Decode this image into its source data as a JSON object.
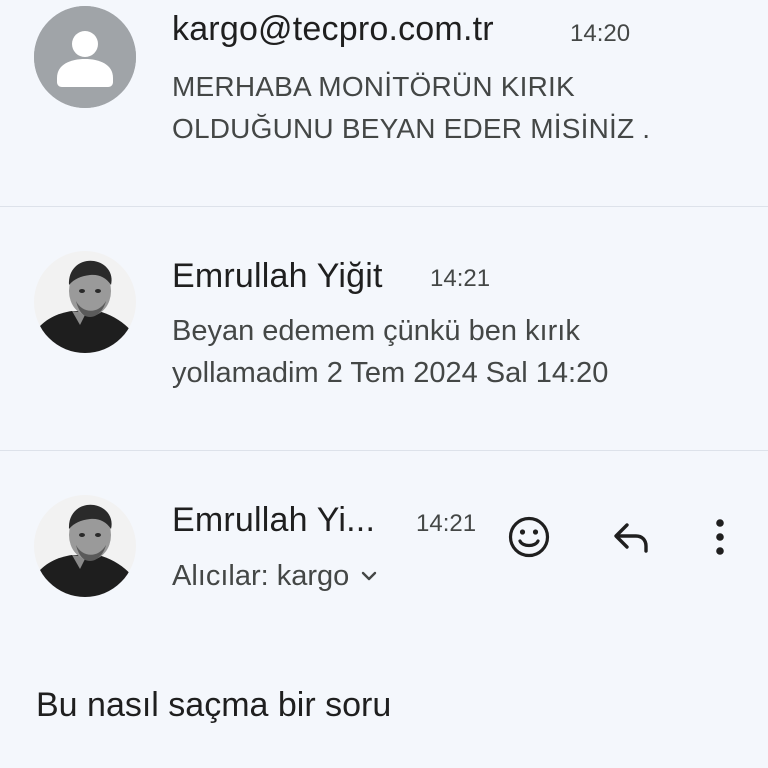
{
  "thread": {
    "messages": [
      {
        "sender": "kargo@tecpro.com.tr",
        "time": "14:20",
        "snippet_line1": "MERHABA MONİTÖRÜN KIRIK",
        "snippet_line2": "OLDUĞUNU BEYAN EDER MİSİNİZ .",
        "avatar_icon": "default-person-icon"
      },
      {
        "sender": "Emrullah Yiğit",
        "time": "14:21",
        "snippet_line1": "Beyan edemem çünkü ben kırık",
        "snippet_line2": "yollamadim 2 Tem 2024 Sal 14:20",
        "avatar_icon": "profile-photo"
      }
    ],
    "open_message": {
      "sender": "Emrullah Yi...",
      "time": "14:21",
      "recipients": "Alıcılar: kargo",
      "body": "Bu nasıl saçma bir soru",
      "actions": [
        "emoji-reaction-icon",
        "reply-icon",
        "more-vert-icon"
      ]
    }
  },
  "colors": {
    "background": "#f4f7fc",
    "primary_text": "#1f1f1f",
    "secondary_text": "#444746",
    "default_avatar_bg": "#a0a4a8",
    "divider": "#dde2ea"
  }
}
